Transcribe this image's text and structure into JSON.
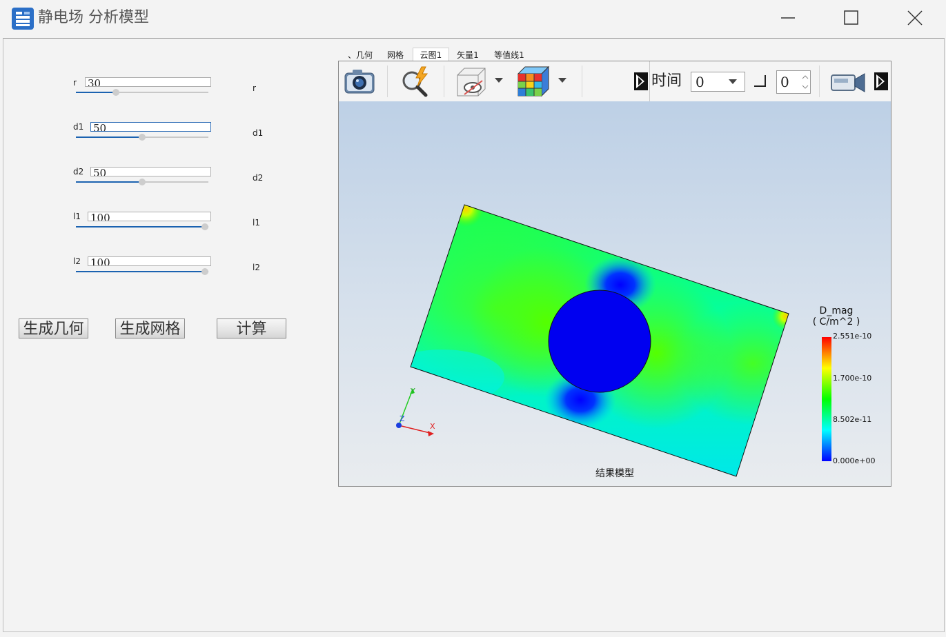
{
  "window": {
    "title": "静电场 分析模型"
  },
  "params": [
    {
      "label": "r",
      "value": "30",
      "unit": "r",
      "position": 0.3,
      "focused": false
    },
    {
      "label": "d1",
      "value": "50",
      "unit": "d1",
      "position": 0.5,
      "focused": true
    },
    {
      "label": "d2",
      "value": "50",
      "unit": "d2",
      "position": 0.5,
      "focused": false
    },
    {
      "label": "l1",
      "value": "100",
      "unit": "l1",
      "position": 1.0,
      "focused": false
    },
    {
      "label": "l2",
      "value": "100",
      "unit": "l2",
      "position": 1.0,
      "focused": false
    }
  ],
  "actions": {
    "geometry_label": "生成几何",
    "mesh_label": "生成网格",
    "compute_label": "计算"
  },
  "tabs": [
    {
      "label": "、几何",
      "active": false
    },
    {
      "label": "网格",
      "active": false
    },
    {
      "label": "云图1",
      "active": true
    },
    {
      "label": "矢量1",
      "active": false
    },
    {
      "label": "等值线1",
      "active": false
    }
  ],
  "toolbar": {
    "time_label": "时间",
    "time_value": "0",
    "step_value": "0"
  },
  "legend": {
    "title_line1": "D_mag",
    "title_line2": "( C/m^2 )",
    "ticks": [
      "2.551e-10",
      "1.700e-10",
      "8.502e-11",
      "0.000e+00"
    ]
  },
  "axes": {
    "x": "X",
    "y": "Y",
    "z": "Z"
  },
  "scene": {
    "caption": "结果模型"
  },
  "icons": {
    "app": "app-logo-icon",
    "minimize": "minimize-icon",
    "maximize": "maximize-icon",
    "close": "close-icon",
    "camera": "camera-icon",
    "zoom": "zoom-lightning-icon",
    "visibility": "hidden-box-icon",
    "colormap": "colormap-cube-icon",
    "record": "video-camera-icon"
  },
  "colors": {
    "accent": "#1b62b0",
    "field_high": "#ff0000",
    "field_mid": "#00ff00",
    "field_low": "#0000ff"
  }
}
